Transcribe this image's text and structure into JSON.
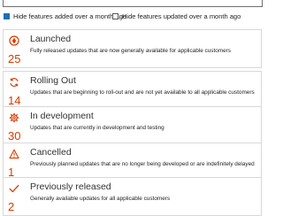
{
  "search": {
    "placeholder": ""
  },
  "filters": [
    {
      "label": "Hide features added over a month ago",
      "checked": true
    },
    {
      "label": "Hide features updated over a month ago",
      "checked": false
    }
  ],
  "accent_color": "#d83b01",
  "checkbox_color": "#1f6fb5",
  "categories": [
    {
      "icon": "rocket-icon",
      "title": "Launched",
      "count": "25",
      "description": "Fully released updates that are now generally available for applicable customers"
    },
    {
      "icon": "refresh-icon",
      "title": "Rolling Out",
      "count": "14",
      "description": "Updates that are beginning to roll-out and are not yet available to all applicable customers"
    },
    {
      "icon": "gear-icon",
      "title": "In development",
      "count": "30",
      "description": "Updates that are currently in development and testing"
    },
    {
      "icon": "warning-icon",
      "title": "Cancelled",
      "count": "1",
      "description": "Previously planned updates that are no longer being developed or are indefinitely delayed"
    },
    {
      "icon": "checkmark-icon",
      "title": "Previously released",
      "count": "2",
      "description": "Generally available updates for all applicable customers"
    }
  ]
}
